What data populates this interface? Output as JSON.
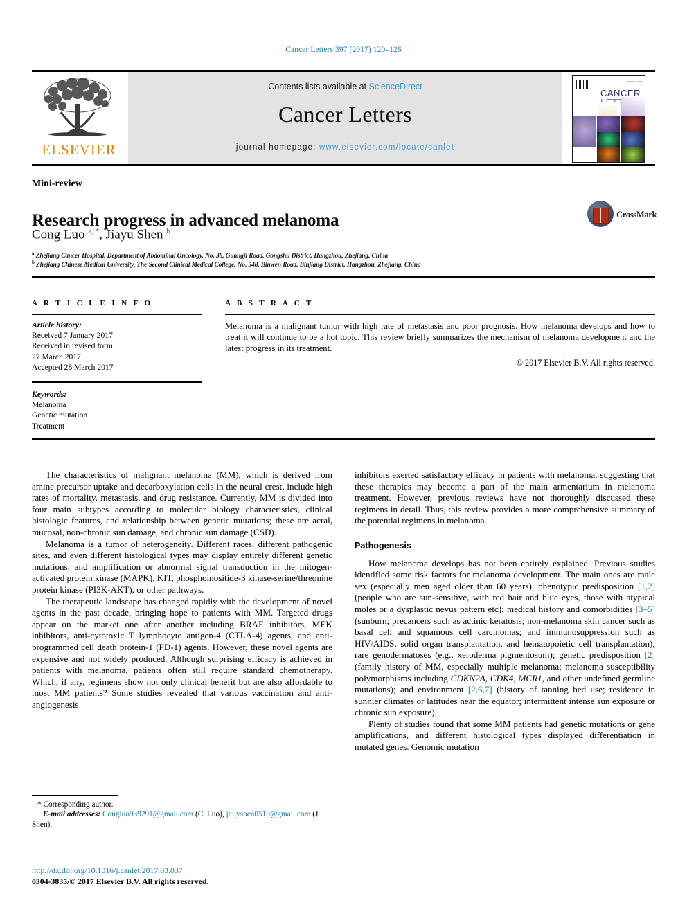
{
  "running_head": "Cancer Letters 397 (2017) 120–126",
  "masthead": {
    "contents_prefix": "Contents lists available at ",
    "contents_link": "ScienceDirect",
    "journal_title": "Cancer Letters",
    "homepage_prefix": "journal homepage: ",
    "homepage_url": "www.elsevier.com/locate/canlet",
    "publisher_logo_text": "ELSEVIER",
    "cover": {
      "title_line1": "CANCER",
      "title_line2": "LETTERS",
      "issn_text": "ISSN 0304-3835"
    }
  },
  "article": {
    "type_label": "Mini-review",
    "title": "Research progress in advanced melanoma",
    "authors_html": "Cong Luo <sup>a, *</sup>, Jiayu Shen <sup>b</sup>",
    "affiliation_a": "Zhejiang Cancer Hospital, Department of Abdominal Oncology, No. 38, Guangji Road, Gongshu District, Hangzhou, Zhejiang, China",
    "affiliation_b": "Zhejiang Chinese Medical University, The Second Clinical Medical College, No. 548, Binwen Road, Binjiang District, Hangzhou, Zhejiang, China",
    "crossmark_label": "CrossMark"
  },
  "article_info": {
    "heading": "A R T I C L E  I N F O",
    "history_label": "Article history:",
    "history_lines": [
      "Received 7 January 2017",
      "Received in revised form",
      "27 March 2017",
      "Accepted 28 March 2017"
    ],
    "keywords_label": "Keywords:",
    "keywords": [
      "Melanoma",
      "Genetic mutation",
      "Treatment"
    ]
  },
  "abstract": {
    "heading": "A B S T R A C T",
    "text": "Melanoma is a malignant tumor with high rate of metastasis and poor prognosis. How melanoma develops and how to treat it will continue to be a hot topic. This review briefly summarizes the mechanism of melanoma development and the latest progress in its treatment.",
    "copyright": "© 2017 Elsevier B.V. All rights reserved."
  },
  "body": {
    "left": {
      "p1": "The characteristics of malignant melanoma (MM), which is derived from amine precursor uptake and decarboxylation cells in the neural crest, include high rates of mortality, metastasis, and drug resistance. Currently, MM is divided into four main subtypes according to molecular biology characteristics, clinical histologic features, and relationship between genetic mutations; these are acral, mucosal, non-chronic sun damage, and chronic sun damage (CSD).",
      "p2": "Melanoma is a tumor of heterogeneity. Different races, different pathogenic sites, and even different histological types may display entirely different genetic mutations, and amplification or abnormal signal transduction in the mitogen-activated protein kinase (MAPK), KIT, phosphoinositide-3 kinase-serine/threonine protein kinase (PI3K-AKT), or other pathways.",
      "p3": "The therapeutic landscape has changed rapidly with the development of novel agents in the past decade, bringing hope to patients with MM. Targeted drugs appear on the market one after another including BRAF inhibitors, MEK inhibitors, anti-cytotoxic T lymphocyte antigen-4 (CTLA-4) agents, and anti-programmed cell death protein-1 (PD-1) agents. However, these novel agents are expensive and not widely produced. Although surprising efficacy is achieved in patients with melanoma, patients often still require standard chemotherapy. Which, if any, regimens show not only clinical benefit but are also affordable to most MM patients? Some studies revealed that various vaccination and anti-angiogenesis"
    },
    "right": {
      "p1": "inhibitors exerted satisfactory efficacy in patients with melanoma, suggesting that these therapies may become a part of the main armentarium in melanoma treatment. However, previous reviews have not thoroughly discussed these regimens in detail. Thus, this review provides a more comprehensive summary of the potential regimens in melanoma.",
      "section_heading": "Pathogenesis",
      "p2_part1": "How melanoma develops has not been entirely explained. Previous studies identified some risk factors for melanoma development. The main ones are male sex (especially men aged older than 60 years); phenotypic predisposition ",
      "p2_ref1": "[1,2]",
      "p2_part2": " (people who are sun-sensitive, with red hair and blue eyes, those with atypical moles or a dysplastic nevus pattern etc); medical history and comorbidities ",
      "p2_ref2": "[3–5]",
      "p2_part3": " (sunburn; precancers such as actinic keratosis; non-melanoma skin cancer such as basal cell and squamous cell carcinomas; and immunosuppression such as HIV/AIDS, solid organ transplantation, and hematopoietic cell transplantation); rare genodermatoses (e.g., xeroderma pigmentosum); genetic predisposition ",
      "p2_ref3": "[2]",
      "p2_part4": " (family history of MM, especially multiple melanoma; melanoma susceptibility polymorphisms including ",
      "p2_genes": "CDKN2A, CDK4, MCR1",
      "p2_part5": ", and other undefined germline mutations); and environment ",
      "p2_ref4": "[2,6,7]",
      "p2_part6": " (history of tanning bed use; residence in sunnier climates or latitudes near the equator; intermittent intense sun exposure or chronic sun exposure).",
      "p3": "Plenty of studies found that some MM patients had genetic mutations or gene amplifications, and different histological types displayed differentiation in mutated genes. Genomic mutation"
    }
  },
  "footnote": {
    "corresponding": "* Corresponding author.",
    "email_label": "E-mail addresses:",
    "email1": "Congluo939291@gmail.com",
    "email1_attrib": "(C. Luo),",
    "email2": "jellyshen0519@gmail.com",
    "email2_attrib": "(J. Shen)."
  },
  "publication": {
    "doi": "http://dx.doi.org/10.1016/j.canlet.2017.03.037",
    "issn_line": "0304-3835/© 2017 Elsevier B.V. All rights reserved."
  }
}
